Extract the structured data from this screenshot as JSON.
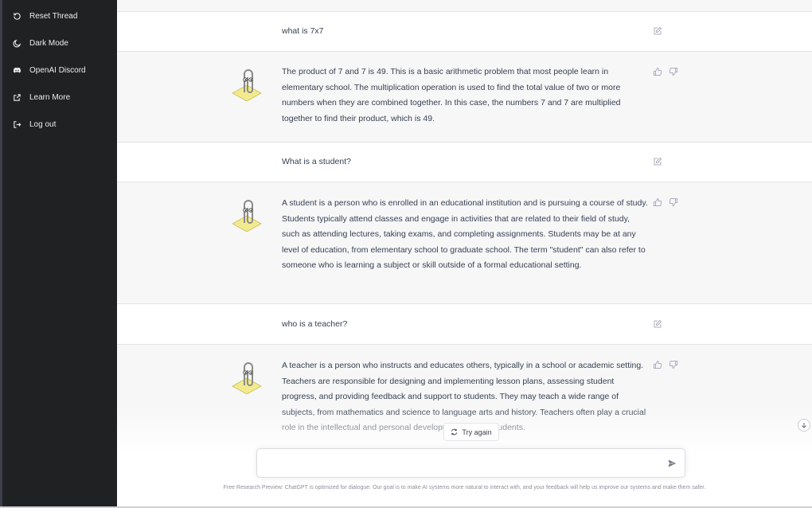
{
  "sidebar": {
    "items": [
      {
        "label": "Reset Thread",
        "icon": "reset-icon"
      },
      {
        "label": "Dark Mode",
        "icon": "moon-icon"
      },
      {
        "label": "OpenAI Discord",
        "icon": "discord-icon"
      },
      {
        "label": "Learn More",
        "icon": "external-link-icon"
      },
      {
        "label": "Log out",
        "icon": "logout-icon"
      }
    ]
  },
  "thread": {
    "messages": [
      {
        "role": "user",
        "text": "what is 7x7"
      },
      {
        "role": "assistant",
        "avatar": "paperclip-avatar",
        "text": "The product of 7 and 7 is 49. This is a basic arithmetic problem that most people learn in elementary school. The multiplication operation is used to find the total value of two or more numbers when they are combined together. In this case, the numbers 7 and 7 are multiplied together to find their product, which is 49."
      },
      {
        "role": "user",
        "text": "What is a student?"
      },
      {
        "role": "assistant",
        "avatar": "paperclip-avatar",
        "text": "A student is a person who is enrolled in an educational institution and is pursuing a course of study. Students typically attend classes and engage in activities that are related to their field of study, such as attending lectures, taking exams, and completing assignments. Students may be at any level of education, from elementary school to graduate school. The term \"student\" can also refer to someone who is learning a subject or skill outside of a formal educational setting."
      },
      {
        "role": "user",
        "text": "who is a teacher?"
      },
      {
        "role": "assistant",
        "avatar": "paperclip-avatar",
        "text": "A teacher is a person who instructs and educates others, typically in a school or academic setting. Teachers are responsible for designing and implementing lesson plans, assessing student progress, and providing feedback and support to students. They may teach a wide range of subjects, from mathematics and science to language arts and history. Teachers often play a crucial role in the intellectual and personal development of their students."
      }
    ]
  },
  "try_again_label": "Try again",
  "input": {
    "value": "",
    "placeholder": ""
  },
  "footer": "Free Research Preview: ChatGPT is optimized for dialogue. Our goal is to make AI systems more natural to interact with, and your feedback will help us improve our systems and make them safer.",
  "colors": {
    "sidebar": "#202123",
    "assistant_bg": "#f7f7f8",
    "text": "#374151"
  }
}
